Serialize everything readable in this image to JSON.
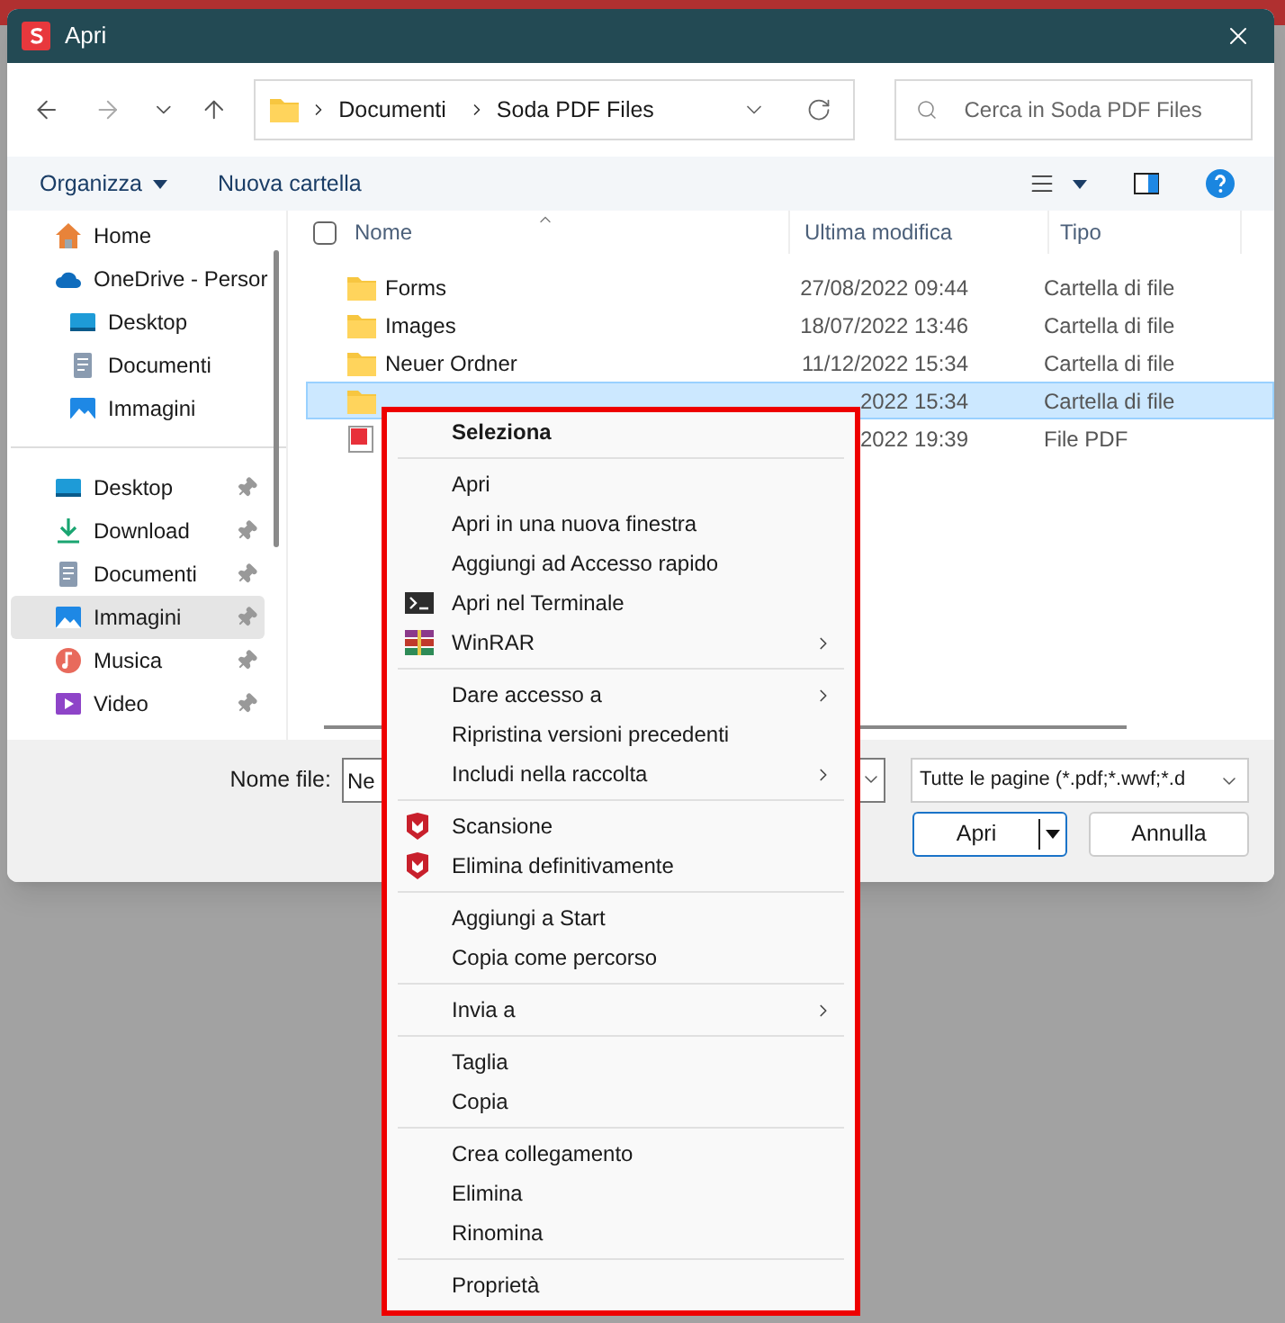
{
  "window": {
    "title": "Apri"
  },
  "navigation": {
    "path": [
      "Documenti",
      "Soda PDF Files"
    ],
    "search": {
      "placeholder": "Cerca in Soda PDF Files"
    }
  },
  "toolbar": {
    "organize": "Organizza",
    "new_folder": "Nuova cartella"
  },
  "sidebar": {
    "sections": [
      {
        "items": [
          {
            "label": "Home",
            "kind": "home",
            "pinned": false,
            "selected": false
          },
          {
            "label": "OneDrive - Persor",
            "kind": "cloud",
            "pinned": false,
            "selected": false,
            "children": [
              {
                "label": "Desktop",
                "kind": "desktop",
                "pinned": false,
                "selected": false
              },
              {
                "label": "Documenti",
                "kind": "document",
                "pinned": false,
                "selected": false
              },
              {
                "label": "Immagini",
                "kind": "image",
                "pinned": false,
                "selected": false
              }
            ]
          }
        ]
      },
      {
        "items": [
          {
            "label": "Desktop",
            "kind": "desktop",
            "pinned": true,
            "selected": false
          },
          {
            "label": "Download",
            "kind": "download",
            "pinned": true,
            "selected": false
          },
          {
            "label": "Documenti",
            "kind": "document",
            "pinned": true,
            "selected": false
          },
          {
            "label": "Immagini",
            "kind": "image",
            "pinned": true,
            "selected": true
          },
          {
            "label": "Musica",
            "kind": "music",
            "pinned": true,
            "selected": false
          },
          {
            "label": "Video",
            "kind": "video",
            "pinned": true,
            "selected": false
          }
        ]
      }
    ]
  },
  "file_list": {
    "select_all_checked": false,
    "columns": [
      "Nome",
      "Ultima modifica",
      "Tipo"
    ],
    "rows": [
      {
        "name": "Forms",
        "kind": "folder",
        "modified": "27/08/2022 09:44",
        "type": "Cartella di file",
        "selected": false
      },
      {
        "name": "Images",
        "kind": "folder",
        "modified": "18/07/2022 13:46",
        "type": "Cartella di file",
        "selected": false
      },
      {
        "name": "Neuer Ordner",
        "kind": "folder",
        "modified": "11/12/2022 15:34",
        "type": "Cartella di file",
        "selected": false
      },
      {
        "kind": "folder",
        "modified": "2022 15:34",
        "type": "Cartella di file",
        "selected": true
      },
      {
        "kind": "pdf",
        "modified": "2022 19:39",
        "type": "File PDF",
        "selected": false
      }
    ]
  },
  "footer": {
    "file_name_label": "Nome file:",
    "file_name_value": "Ne",
    "file_type": "Tutte le pagine (*.pdf;*.wwf;*.d",
    "buttons": [
      {
        "label": "Apri",
        "kind": "split"
      },
      {
        "label": "Annulla",
        "kind": "plain"
      }
    ]
  },
  "context_menu": {
    "groups": [
      [
        {
          "label": "Seleziona",
          "kind": "default",
          "submenu": false
        }
      ],
      [
        {
          "label": "Apri",
          "kind": "plain",
          "submenu": false
        },
        {
          "label": "Apri in una nuova finestra",
          "kind": "plain",
          "submenu": false
        },
        {
          "label": "Aggiungi ad Accesso rapido",
          "kind": "plain",
          "submenu": false
        },
        {
          "label": "Apri nel Terminale",
          "kind": "terminal",
          "submenu": false
        },
        {
          "label": "WinRAR",
          "kind": "archive",
          "submenu": true
        }
      ],
      [
        {
          "label": "Dare accesso a",
          "kind": "plain",
          "submenu": true
        },
        {
          "label": "Ripristina versioni precedenti",
          "kind": "plain",
          "submenu": false
        },
        {
          "label": "Includi nella raccolta",
          "kind": "plain",
          "submenu": true
        }
      ],
      [
        {
          "label": "Scansione",
          "kind": "shield",
          "submenu": false
        },
        {
          "label": "Elimina definitivamente",
          "kind": "shield",
          "submenu": false
        }
      ],
      [
        {
          "label": "Aggiungi a Start",
          "kind": "plain",
          "submenu": false
        },
        {
          "label": "Copia come percorso",
          "kind": "plain",
          "submenu": false
        }
      ],
      [
        {
          "label": "Invia a",
          "kind": "plain",
          "submenu": true
        }
      ],
      [
        {
          "label": "Taglia",
          "kind": "plain",
          "submenu": false
        },
        {
          "label": "Copia",
          "kind": "plain",
          "submenu": false
        }
      ],
      [
        {
          "label": "Crea collegamento",
          "kind": "plain",
          "submenu": false
        },
        {
          "label": "Elimina",
          "kind": "plain",
          "submenu": false
        },
        {
          "label": "Rinomina",
          "kind": "plain",
          "submenu": false
        }
      ],
      [
        {
          "label": "Proprietà",
          "kind": "plain",
          "submenu": false
        }
      ]
    ]
  }
}
